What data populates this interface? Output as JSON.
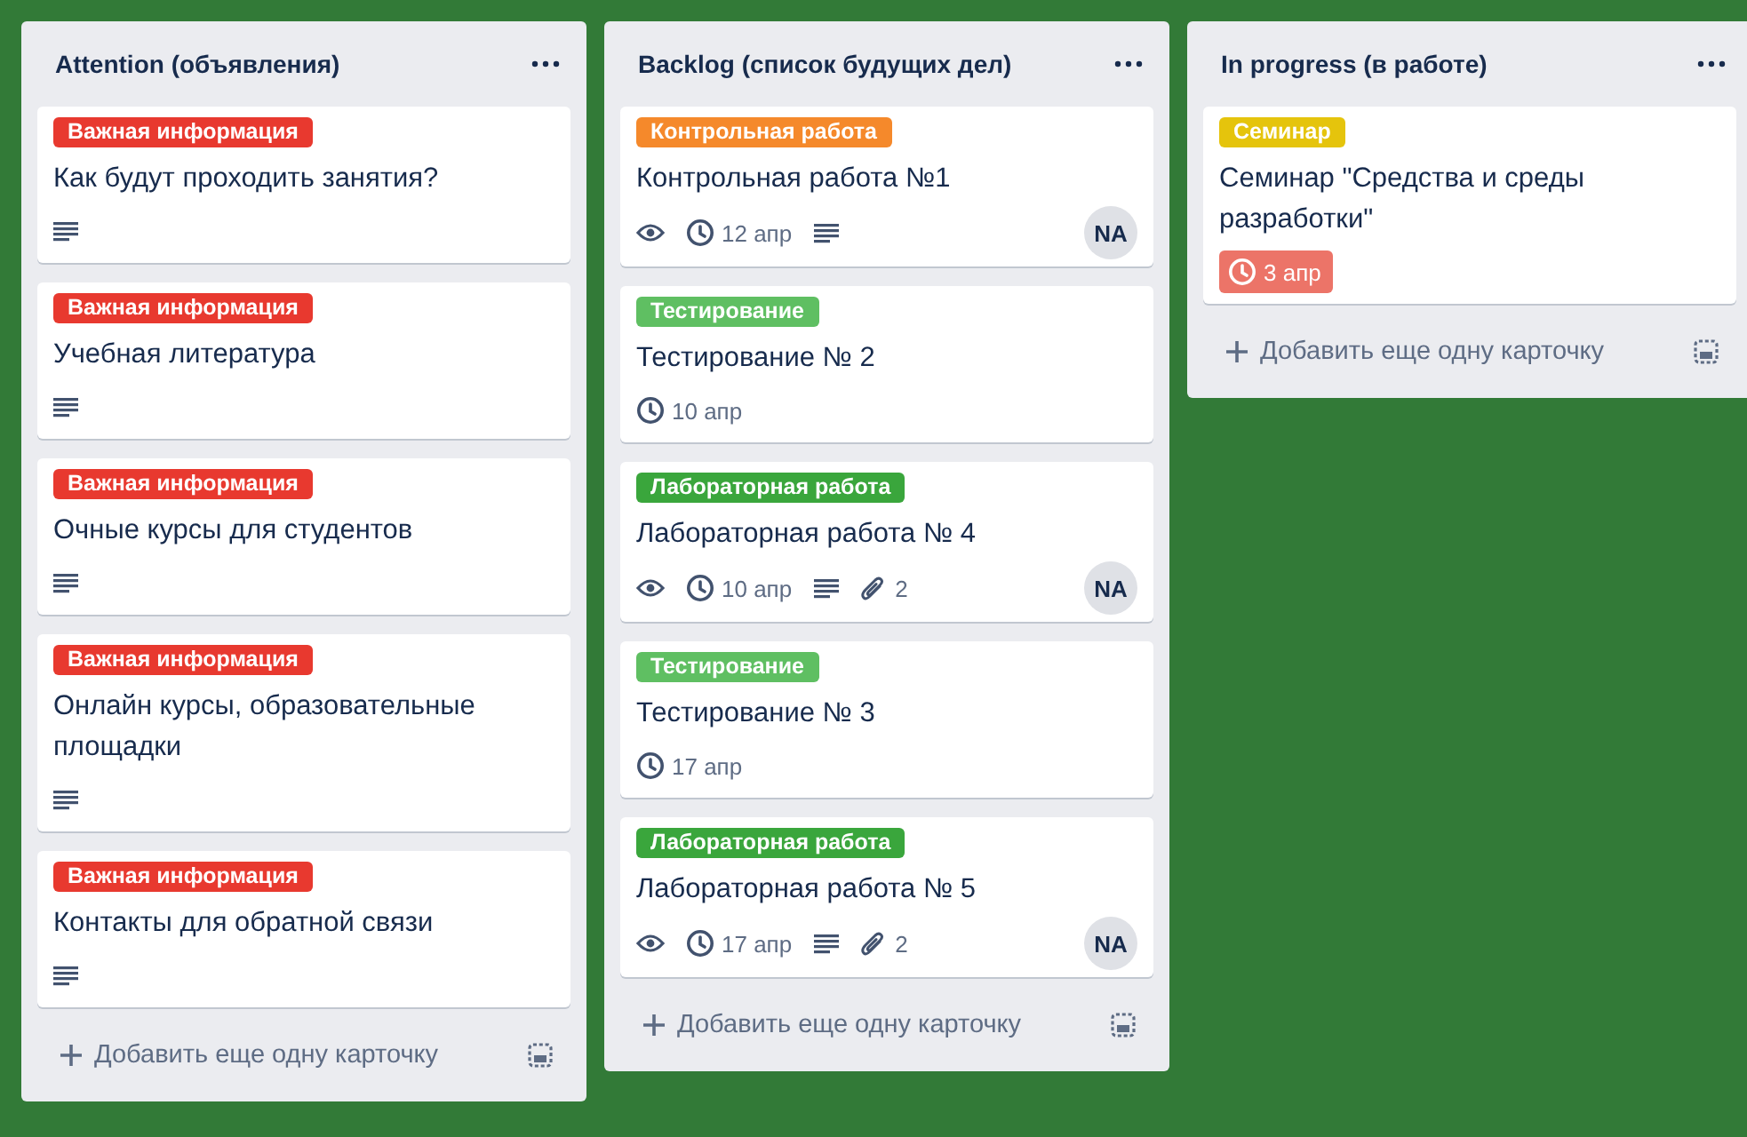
{
  "lists": [
    {
      "title": "Attention (объявления)",
      "cards": [
        {
          "label": {
            "text": "Важная информация",
            "color": "#e8392f"
          },
          "title": "Как будут проходить занятия?",
          "badges": [
            {
              "kind": "description"
            }
          ]
        },
        {
          "label": {
            "text": "Важная информация",
            "color": "#e8392f"
          },
          "title": "Учебная литература",
          "badges": [
            {
              "kind": "description"
            }
          ]
        },
        {
          "label": {
            "text": "Важная информация",
            "color": "#e8392f"
          },
          "title": "Очные курсы для студентов",
          "badges": [
            {
              "kind": "description"
            }
          ]
        },
        {
          "label": {
            "text": "Важная информация",
            "color": "#e8392f"
          },
          "title": "Онлайн курсы, образовательные площадки",
          "badges": [
            {
              "kind": "description"
            }
          ]
        },
        {
          "label": {
            "text": "Важная информация",
            "color": "#e8392f"
          },
          "title": "Контакты для обратной связи",
          "badges": [
            {
              "kind": "description"
            }
          ]
        }
      ],
      "add_card": "Добавить еще одну карточку"
    },
    {
      "title": "Backlog (список будущих дел)",
      "cards": [
        {
          "label": {
            "text": "Контрольная работа",
            "color": "#f5892b"
          },
          "title": "Контрольная работа №1",
          "badges": [
            {
              "kind": "watch"
            },
            {
              "kind": "due",
              "text": "12 апр",
              "overdue": false
            },
            {
              "kind": "description"
            }
          ],
          "member": "NA"
        },
        {
          "label": {
            "text": "Тестирование",
            "color": "#5fbf62"
          },
          "title": "Тестирование № 2",
          "badges": [
            {
              "kind": "due",
              "text": "10 апр",
              "overdue": false
            }
          ]
        },
        {
          "label": {
            "text": "Лабораторная работа",
            "color": "#3aa63c"
          },
          "title": "Лабораторная работа № 4",
          "badges": [
            {
              "kind": "watch"
            },
            {
              "kind": "due",
              "text": "10 апр",
              "overdue": false
            },
            {
              "kind": "description"
            },
            {
              "kind": "attachments",
              "text": "2"
            }
          ],
          "member": "NA"
        },
        {
          "label": {
            "text": "Тестирование",
            "color": "#5fbf62"
          },
          "title": "Тестирование № 3",
          "badges": [
            {
              "kind": "due",
              "text": "17 апр",
              "overdue": false
            }
          ]
        },
        {
          "label": {
            "text": "Лабораторная работа",
            "color": "#3aa63c"
          },
          "title": "Лабораторная работа № 5",
          "badges": [
            {
              "kind": "watch"
            },
            {
              "kind": "due",
              "text": "17 апр",
              "overdue": false
            },
            {
              "kind": "description"
            },
            {
              "kind": "attachments",
              "text": "2"
            }
          ],
          "member": "NA"
        }
      ],
      "add_card": "Добавить еще одну карточку"
    },
    {
      "title": "In progress (в работе)",
      "cards": [
        {
          "label": {
            "text": "Семинар",
            "color": "#e5c40c"
          },
          "title": "Семинар \"Средства и среды разработки\"",
          "badges": [
            {
              "kind": "due",
              "text": "3 апр",
              "overdue": true
            }
          ]
        }
      ],
      "add_card": "Добавить еще одну карточку"
    }
  ]
}
